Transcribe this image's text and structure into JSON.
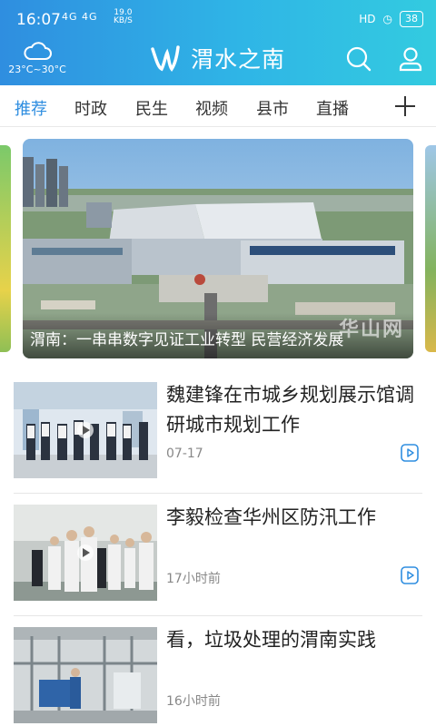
{
  "status_bar": {
    "time": "16:07",
    "signal": "4G 4G",
    "net_speed": "19.0",
    "net_unit": "KB/S",
    "battery": "38"
  },
  "app_bar": {
    "weather_temp": "23°C~30°C",
    "app_name": "渭水之南",
    "weather_icon": "cloud-icon",
    "search_icon": "search-icon",
    "profile_icon": "user-icon",
    "accent_color": "#2f8ee0"
  },
  "tabs": [
    {
      "label": "推荐",
      "active": true
    },
    {
      "label": "时政"
    },
    {
      "label": "民生"
    },
    {
      "label": "视频"
    },
    {
      "label": "县市"
    },
    {
      "label": "直播"
    }
  ],
  "carousel": {
    "caption": "渭南：一串串数字见证工业转型 民营经济发展",
    "watermark": "华山网"
  },
  "news": [
    {
      "title": "魏建锋在市城乡规划展示馆调研城市规划工作",
      "time": "07-17",
      "video": true
    },
    {
      "title": "李毅检查华州区防汛工作",
      "time": "17小时前",
      "video": true
    },
    {
      "title": "看，垃圾处理的渭南实践",
      "time": "16小时前",
      "video": false
    }
  ]
}
